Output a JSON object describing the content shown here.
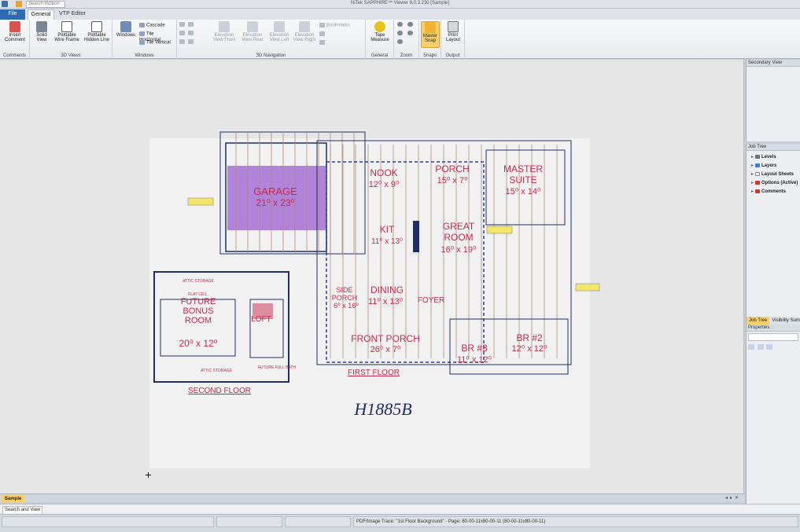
{
  "window": {
    "title": "NiTek SAPPHIRE™ Viewer 8.0.3.230 [Sample]",
    "search_placeholder": "Search Ribbon"
  },
  "tabs": {
    "file": "File",
    "general": "General",
    "vtp_editor": "VTP Editor"
  },
  "ribbon": {
    "comments": {
      "group": "Comments",
      "insert": "Insert Comment"
    },
    "views3d": {
      "group": "3D Views",
      "solid": "Solid View",
      "wireframe": "Plottable Wire Frame",
      "hiddenline": "Plottable Hidden Line"
    },
    "windows": {
      "group": "Windows",
      "windows": "Windows",
      "cascade": "Cascade",
      "tile_h": "Tile Horizontal",
      "tile_v": "Tile Vertical"
    },
    "nav3d": {
      "group": "3D Navigation",
      "front": "Elevation View Front",
      "rear": "Elevation View Rear",
      "left": "Elevation View Left",
      "right": "Elevation View Right",
      "bookmarks": "Bookmarks"
    },
    "general": {
      "group": "General",
      "tape": "Tape Measure"
    },
    "zoom": {
      "group": "Zoom"
    },
    "snaps": {
      "group": "Snaps",
      "master": "Master Snap"
    },
    "output": {
      "group": "Output",
      "print": "Print Layout"
    }
  },
  "panels": {
    "secondary_view": "Secondary View",
    "job_tree": "Job Tree",
    "tree_items": [
      "Levels",
      "Layers",
      "Layout Sheets",
      "Options (Active)",
      "Comments"
    ],
    "panel_tabs": [
      "Job Tree",
      "Visibility Sum"
    ],
    "properties": "Properties"
  },
  "plan": {
    "garage": "GARAGE",
    "garage_dim": "21⁰ x 23⁰",
    "nook": "NOOK",
    "nook_dim": "12⁰ x 9⁰",
    "porch": "PORCH",
    "porch_dim": "15⁰ x 7⁰",
    "master": "MASTER",
    "suite": "SUITE",
    "master_dim": "15⁰ x 14⁰",
    "kit": "KIT",
    "kit_dim": "11⁰ x 13⁰",
    "great": "GREAT",
    "room": "ROOM",
    "great_dim": "16⁰ x 19⁰",
    "side": "SIDE",
    "side_porch": "PORCH",
    "side_dim": "6⁰ x 16⁰",
    "dining": "DINING",
    "dining_dim": "11⁰ x 13⁰",
    "foyer": "FOYER",
    "front_porch": "FRONT PORCH",
    "front_porch_dim": "26⁰ x 7⁰",
    "br3": "BR #3",
    "br3_dim": "11⁰ x 12⁰",
    "br2": "BR #2",
    "br2_dim": "12⁰ x 12⁰",
    "first_floor": "FIRST FLOOR",
    "future_bonus": "FUTURE",
    "bonus": "BONUS",
    "bonus_room": "ROOM",
    "bonus_dim": "20⁰ x 12⁰",
    "loft": "LOFT",
    "attic_storage": "ATTIC STORAGE",
    "flat_ceil": "FLAT CEIL.",
    "future_bath": "FUTURE FULL BATH",
    "second_floor": "SECOND FLOOR",
    "plan_name": "H1885B"
  },
  "doc_tab": "Sample",
  "search_view": "Search and View",
  "status": {
    "trace": "PDF/Image Trace: \"1st Floor Background\"  -  Page: 80-00-11x80-00-11 (80-00-11x80-00-11)"
  },
  "colors": {
    "accent": "#2e6bb5",
    "highlight": "#f8cf6a",
    "plan_red": "#c8294a",
    "plan_navy": "#1f2d6b",
    "garage_fill": "#9b5fd1",
    "rafter": "#b08a78"
  }
}
